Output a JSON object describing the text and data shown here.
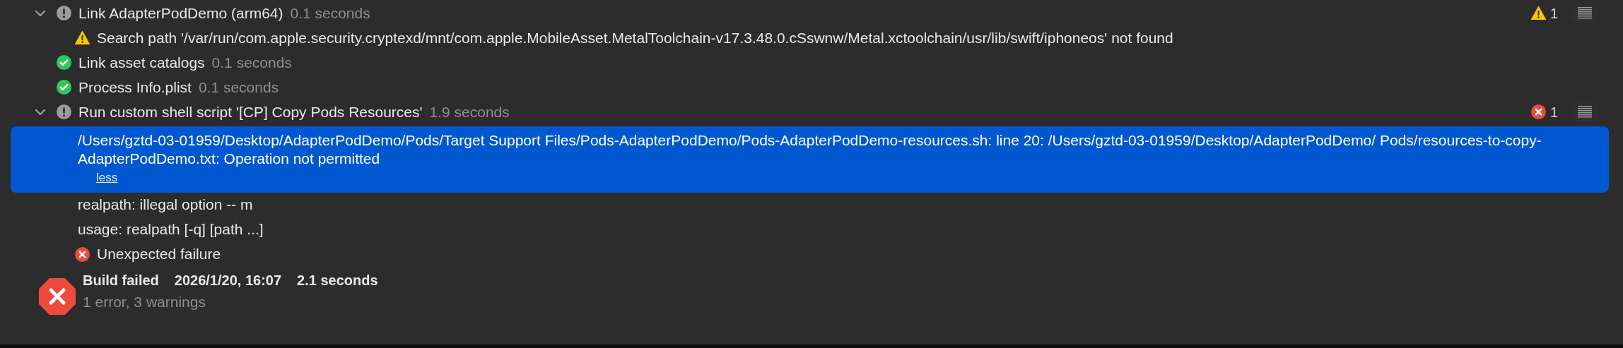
{
  "log": [
    {
      "kind": "info",
      "expanded": true,
      "title": "Link AdapterPodDemo (arm64)",
      "duration": "0.1 seconds",
      "badge": {
        "kind": "warning",
        "count": "1"
      },
      "children": [
        {
          "kind": "warning",
          "selected": false,
          "text": "Search path '/var/run/com.apple.security.cryptexd/mnt/com.apple.MobileAsset.MetalToolchain-v17.3.48.0.cSswnw/Metal.xctoolchain/usr/lib/swift/iphoneos' not found"
        }
      ]
    },
    {
      "kind": "success",
      "title": "Link asset catalogs",
      "duration": "0.1 seconds"
    },
    {
      "kind": "success",
      "title": "Process Info.plist",
      "duration": "0.1 seconds"
    },
    {
      "kind": "info",
      "expanded": true,
      "title": "Run custom shell script '[CP] Copy Pods Resources'",
      "duration": "1.9 seconds",
      "badge": {
        "kind": "error",
        "count": "1"
      },
      "children": [
        {
          "kind": "text",
          "selected": true,
          "text": "/Users/gztd-03-01959/Desktop/AdapterPodDemo/Pods/Target Support Files/Pods-AdapterPodDemo/Pods-AdapterPodDemo-resources.sh: line 20: /Users/gztd-03-01959/Desktop/AdapterPodDemo/ Pods/resources-to-copy-AdapterPodDemo.txt: Operation not permitted",
          "toggle": "less"
        },
        {
          "kind": "text",
          "selected": false,
          "text": "realpath: illegal option -- m"
        },
        {
          "kind": "text",
          "selected": false,
          "text": "usage: realpath [-q] [path ...]"
        },
        {
          "kind": "error",
          "selected": false,
          "text": "Unexpected failure"
        }
      ]
    }
  ],
  "summary": {
    "kind": "failed",
    "title": "Build failed",
    "date": "2026/1/20, 16:07",
    "duration": "2.1 seconds",
    "counts": "1 error, 3 warnings"
  }
}
